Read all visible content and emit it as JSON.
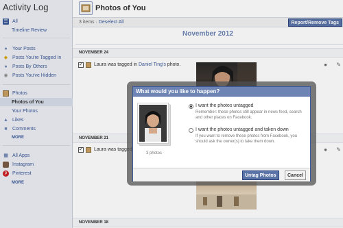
{
  "sidebar": {
    "title": "Activity Log",
    "items": [
      {
        "label": "All",
        "icon": "list-icon"
      },
      {
        "label": "Timeline Review",
        "icon": ""
      },
      {
        "label": "Your Posts",
        "icon": "person-icon"
      },
      {
        "label": "Posts You're Tagged In",
        "icon": "tag-icon"
      },
      {
        "label": "Posts By Others",
        "icon": "people-icon"
      },
      {
        "label": "Posts You've Hidden",
        "icon": "hidden-icon"
      },
      {
        "label": "Photos",
        "icon": "photo-icon"
      },
      {
        "label": "Photos of You",
        "icon": ""
      },
      {
        "label": "Your Photos",
        "icon": ""
      },
      {
        "label": "Likes",
        "icon": "thumbs-up-icon"
      },
      {
        "label": "Comments",
        "icon": "comment-icon"
      },
      {
        "label": "All Apps",
        "icon": "apps-icon"
      },
      {
        "label": "Instagram",
        "icon": "instagram-icon"
      },
      {
        "label": "Pinterest",
        "icon": "pinterest-icon"
      }
    ],
    "more1": "MORE",
    "more2": "MORE"
  },
  "header": {
    "title": "Photos of You"
  },
  "toolbar": {
    "count_prefix": "3 items · ",
    "deselect": "Deselect All",
    "report_button": "Report/Remove Tags"
  },
  "month": "November 2012",
  "entries": [
    {
      "date": "NOVEMBER 24",
      "text_prefix": "Laura was tagged in ",
      "link": "Daniel Ting's",
      "text_suffix": " photo."
    },
    {
      "date": "NOVEMBER 21",
      "text_prefix": "Laura was tagged in ",
      "link": "",
      "text_suffix": ""
    },
    {
      "date": "NOVEMBER 18"
    }
  ],
  "dialog": {
    "title": "What would you like to happen?",
    "photo_caption": "3 photos",
    "option1_label": "I want the photos untagged",
    "option1_desc": "Remember: these photos still appear in news feed, search and other places on Facebook.",
    "option2_label": "I want the photos untagged and taken down",
    "option2_desc": "If you want to remove these photos from Facebook, you should ask the owner(s) to take them down.",
    "untag_button": "Untag Photos",
    "cancel_button": "Cancel"
  }
}
